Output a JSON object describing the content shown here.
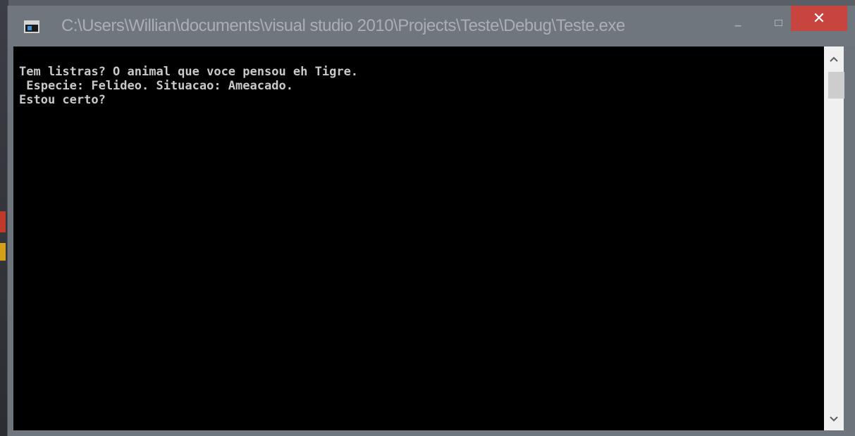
{
  "window": {
    "title": "C:\\Users\\Willian\\documents\\visual studio 2010\\Projects\\Teste\\Debug\\Teste.exe",
    "icon": "console-app-icon",
    "controls": {
      "minimize_glyph": "–",
      "close_glyph": "✕"
    }
  },
  "console": {
    "lines": [
      "Tem listras? O animal que voce pensou eh Tigre.",
      " Especie: Felideo. Situacao: Ameacado.",
      "Estou certo?"
    ]
  },
  "colors": {
    "titlebar": "#6f767d",
    "close": "#c7443f",
    "console_bg": "#000000",
    "console_fg": "#c9c9c9"
  }
}
